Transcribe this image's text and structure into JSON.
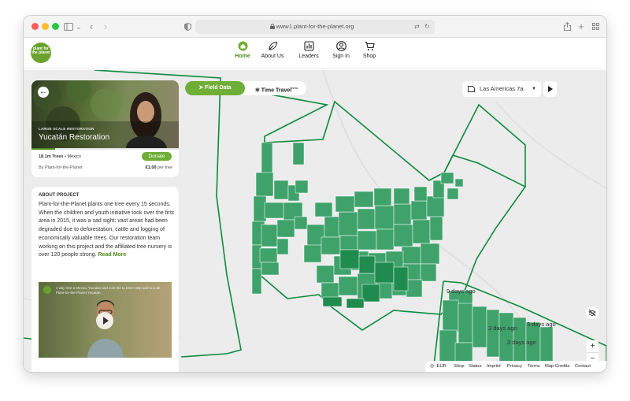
{
  "browser": {
    "url": "www1.plant-for-the-planet.org"
  },
  "header": {
    "logo_text": "plant for the planet",
    "nav": [
      {
        "label": "Home",
        "icon": "home-icon",
        "active": true
      },
      {
        "label": "About Us",
        "icon": "leaf-icon",
        "active": false
      },
      {
        "label": "Leaders",
        "icon": "leaderboard-icon",
        "active": false
      },
      {
        "label": "Sign In",
        "icon": "user-icon",
        "active": false
      },
      {
        "label": "Shop",
        "icon": "cart-icon",
        "active": false
      }
    ]
  },
  "project": {
    "kicker": "LARGE SCALE RESTORATION",
    "title": "Yucatán Restoration",
    "trees": "18.1m Trees",
    "country": "Mexico",
    "donate_label": "Donate",
    "by": "By Plant-for-the-Planet",
    "price": "€1.00",
    "price_unit": "per tree",
    "progress": 0.16
  },
  "about": {
    "title": "ABOUT PROJECT",
    "body": "Plant-for-the-Planet plants one tree every 15 seconds. When the children and youth initiative took over the first area in 2015, it was a sad sight: vast areas had been degraded due to deforestation, cattle and logging of economically valuable trees. Our restoration team working on this project and the affiliated tree nursery is over 120 people strong.",
    "read_more": "Read More",
    "video_caption": "A day tree a Mexico Yucatan and Join the tu treer Help and to a de Plant-for-the-Planet Yucatan"
  },
  "map": {
    "toggle_field": "Field Data",
    "toggle_time": "Time Travel",
    "toggle_time_badge": "beta",
    "site": "Las Americas 7a",
    "labels": [
      "9 days ago",
      "3 days ago",
      "3 days ago",
      "3 days ago"
    ],
    "zoom_in": "+",
    "zoom_out": "−"
  },
  "footer": {
    "currency": "EUR",
    "links": [
      "Shop",
      "Status",
      "Imprint",
      "Privacy",
      "Terms",
      "Map Credits",
      "Contact"
    ]
  },
  "colors": {
    "brand_green": "#6fae37",
    "plot_green": "#2e9c5e",
    "boundary_green": "#0e8a3e"
  }
}
